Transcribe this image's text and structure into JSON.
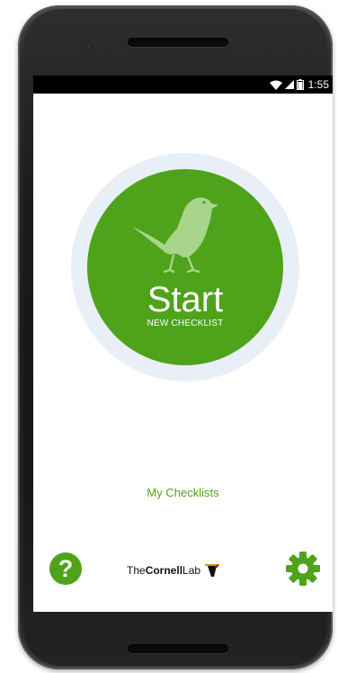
{
  "status_bar": {
    "time": "1:55",
    "icons": [
      "wifi-icon",
      "signal-icon",
      "battery-icon"
    ]
  },
  "main": {
    "start_button": {
      "label": "Start",
      "sublabel": "NEW CHECKLIST",
      "icon": "bird-icon"
    },
    "my_checklists_link": "My Checklists"
  },
  "footer": {
    "help_icon": "help-icon",
    "help_glyph": "?",
    "logo": {
      "prefix": "The",
      "bold": "Cornell",
      "suffix": "Lab"
    },
    "settings_icon": "gear-icon"
  },
  "colors": {
    "accent": "#4ea31a",
    "halo": "#e9eff6",
    "status_bar": "#000000"
  }
}
